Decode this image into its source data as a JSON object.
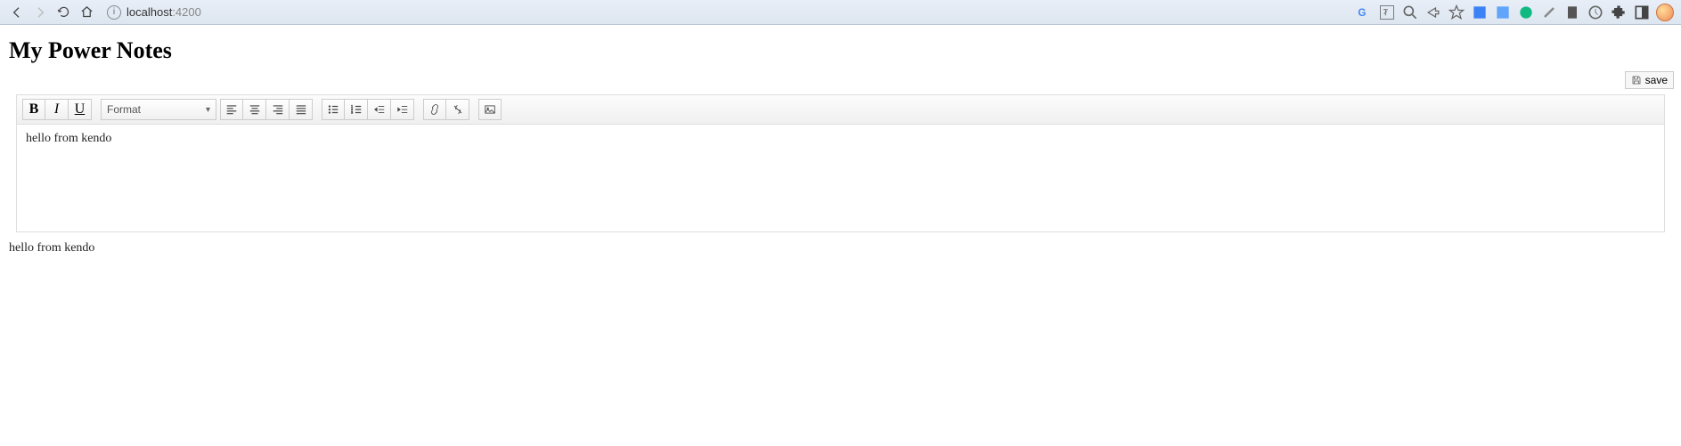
{
  "browser": {
    "url_host": "localhost",
    "url_port": ":4200"
  },
  "page": {
    "title": "My Power Notes",
    "save_label": "save"
  },
  "editor": {
    "format_label": "Format",
    "content": "hello from kendo"
  },
  "output": {
    "text": "hello from kendo"
  },
  "icons": {
    "bold": "B",
    "italic": "I",
    "underline": "U"
  }
}
